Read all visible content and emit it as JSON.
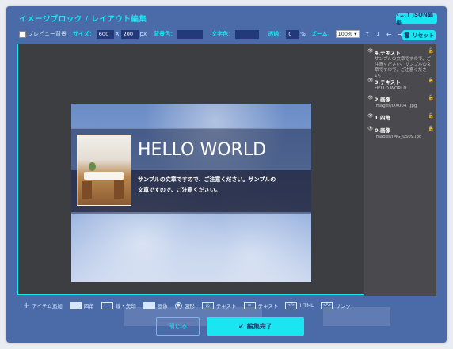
{
  "title": "イメージブロック / レイアウト編集",
  "json_button": "{...} JSON編集",
  "reset_button": "リセット",
  "toolbar": {
    "preview_bg": "プレビュー背景",
    "size_label": "サイズ：",
    "width": "600",
    "x": "X",
    "height": "200",
    "px": "px",
    "bg_color_label": "背景色：",
    "text_color_label": "文字色：",
    "opacity_label": "透過：",
    "opacity": "0",
    "percent": "%",
    "zoom_label": "ズーム：",
    "zoom": "100%"
  },
  "canvas": {
    "heading": "HELLO WORLD",
    "body": "サンプルの文章ですので、ご注意ください。サンプルの文章ですので、ご注意ください。"
  },
  "layers": [
    {
      "name": "4.テキスト",
      "desc": "サンプルの文章ですので、ご注意ください。サンプルの文章ですので、ご注意ください。"
    },
    {
      "name": "3.テキスト",
      "desc": "HELLO WORLD"
    },
    {
      "name": "2.画像",
      "desc": "images/DX004_.jpg"
    },
    {
      "name": "1.四角",
      "desc": ""
    },
    {
      "name": "0.画像",
      "desc": "images/IMG_0509.jpg"
    }
  ],
  "items": {
    "add": "アイテム追加",
    "rect": "四角",
    "line": "線・矢印",
    "image": "画像",
    "shape": "図形",
    "text1": "テキスト",
    "text2": "テキスト",
    "html": "HTML",
    "link": "リンク",
    "text_icon": "あ",
    "html_icon": "</>",
    "link_icon": "<A>"
  },
  "close_button": "閉じる",
  "done_button": "編集完了",
  "colors": {
    "accent": "#19e6f0",
    "panel": "#4a6aa8",
    "editor_bg": "#3d3e42"
  }
}
